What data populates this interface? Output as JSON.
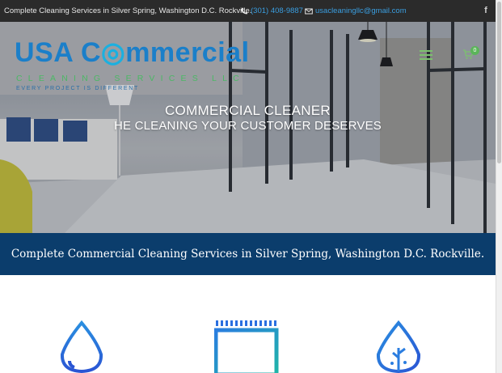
{
  "topbar": {
    "tagline": "Complete Cleaning Services in Silver Spring, Washington D.C. Rockville.",
    "phone": "(301) 408-9887",
    "email": "usacleaningllc@gmail.com",
    "social_icon": "facebook-icon"
  },
  "logo": {
    "line1_a": "USA C",
    "line1_b": "mmercial",
    "line2": "CLEANING SERVICES LLC",
    "line3": "EVERY PROJECT IS DIFFERENT"
  },
  "header": {
    "cart_count": "0",
    "menu_icon": "hamburger-icon",
    "cart_icon": "cart-icon"
  },
  "hero": {
    "title": "COMMERCIAL CLEANER",
    "subtitle": "HE CLEANING YOUR CUSTOMER DESERVES"
  },
  "band": {
    "text": "Complete Commercial Cleaning Services in Silver Spring, Washington D.C. Rockville."
  },
  "features": [
    {
      "icon": "water-drop-icon"
    },
    {
      "icon": "building-icon"
    },
    {
      "icon": "plant-drop-icon"
    }
  ],
  "colors": {
    "topbar_bg": "#2b2b2b",
    "link": "#3a9ee0",
    "brand_blue": "#1b7fc9",
    "brand_green": "#4bb865",
    "band_bg": "#0b3d6c"
  }
}
